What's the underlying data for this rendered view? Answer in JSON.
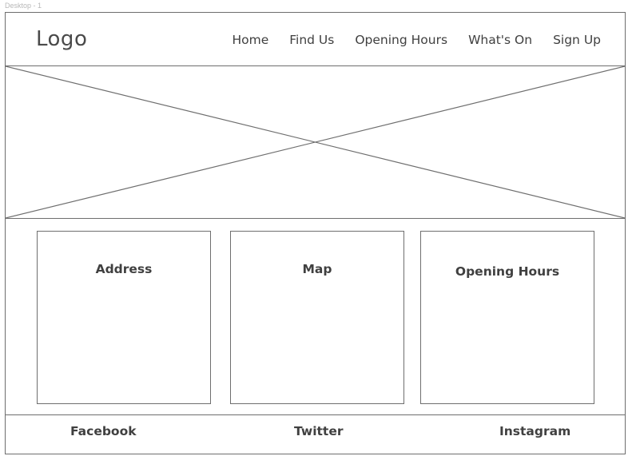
{
  "artboard": {
    "label": "Desktop - 1"
  },
  "header": {
    "logo_text": "Logo",
    "nav": [
      {
        "label": "Home"
      },
      {
        "label": "Find Us"
      },
      {
        "label": "Opening Hours"
      },
      {
        "label": "What's On"
      },
      {
        "label": "Sign Up"
      }
    ]
  },
  "hero": {
    "icon": "image-placeholder-icon"
  },
  "cards": [
    {
      "title": "Address"
    },
    {
      "title": "Map"
    },
    {
      "title": "Opening Hours"
    }
  ],
  "footer": {
    "links": [
      {
        "label": "Facebook"
      },
      {
        "label": "Twitter"
      },
      {
        "label": "Instagram"
      }
    ]
  },
  "colors": {
    "line": "#6e6e6e",
    "text": "#404040",
    "artboard_label": "#b8b8b8"
  }
}
